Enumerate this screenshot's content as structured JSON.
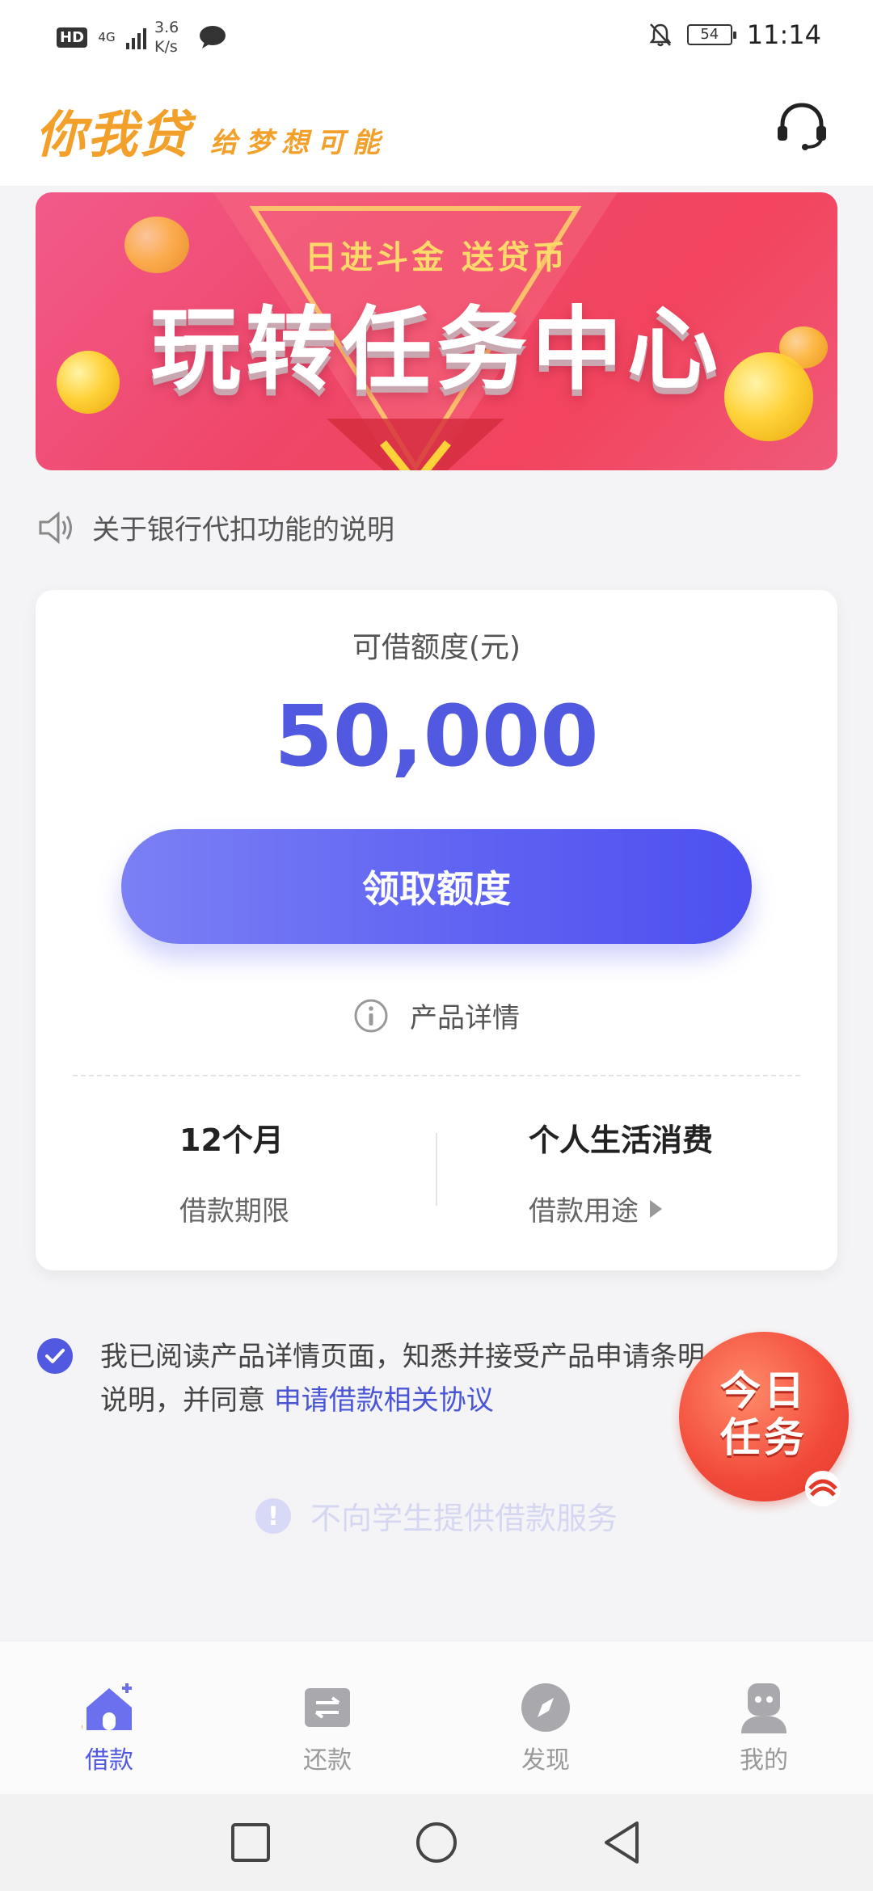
{
  "status_bar": {
    "hd": "HD",
    "network": "4G",
    "speed_value": "3.6",
    "speed_unit": "K/s",
    "battery": "54",
    "time": "11:14"
  },
  "header": {
    "brand_name": "你我贷",
    "slogan": "给梦想可能",
    "support_icon": "headset-icon"
  },
  "banner": {
    "subtitle": "日进斗金 送贷币",
    "title": "玩转任务中心"
  },
  "notice": {
    "icon": "speaker-icon",
    "text": "关于银行代扣功能的说明"
  },
  "card": {
    "quota_label": "可借额度(元)",
    "quota_value": "50,000",
    "claim_button": "领取额度",
    "detail_label": "产品详情",
    "term_value": "12个月",
    "term_label": "借款期限",
    "purpose_value": "个人生活消费",
    "purpose_label": "借款用途"
  },
  "agreement": {
    "checked": true,
    "text_line1": "我已阅读产品详情页面，知悉并接受产品申请条",
    "text_line1_tail": "明",
    "text_line2": "说明，并同意 ",
    "link": "申请借款相关协议"
  },
  "float_task": {
    "line1": "今日",
    "line2": "任务"
  },
  "student_notice": {
    "text": "不向学生提供借款服务"
  },
  "bottom_nav": {
    "items": [
      {
        "label": "借款",
        "icon": "home-icon",
        "active": true
      },
      {
        "label": "还款",
        "icon": "repay-icon",
        "active": false
      },
      {
        "label": "发现",
        "icon": "compass-icon",
        "active": false
      },
      {
        "label": "我的",
        "icon": "profile-icon",
        "active": false
      }
    ]
  },
  "colors": {
    "primary": "#5059e0",
    "brand": "#f2a02a",
    "banner": "#ef4668"
  }
}
